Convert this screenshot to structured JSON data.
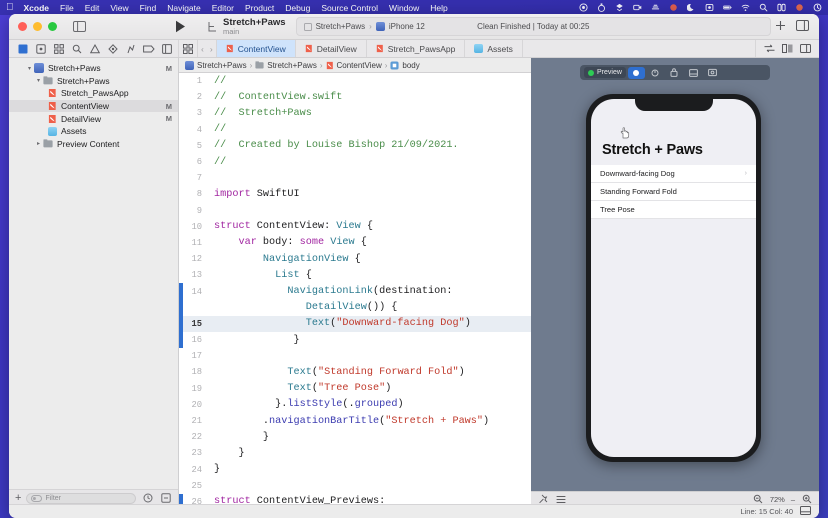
{
  "menubar": {
    "apple_icon": "apple-icon",
    "items": [
      {
        "label": "Xcode",
        "bold": true
      },
      {
        "label": "File",
        "bold": false
      },
      {
        "label": "Edit",
        "bold": false
      },
      {
        "label": "View",
        "bold": false
      },
      {
        "label": "Find",
        "bold": false
      },
      {
        "label": "Navigate",
        "bold": false
      },
      {
        "label": "Editor",
        "bold": false
      },
      {
        "label": "Product",
        "bold": false
      },
      {
        "label": "Debug",
        "bold": false
      },
      {
        "label": "Source Control",
        "bold": false
      },
      {
        "label": "Window",
        "bold": false
      },
      {
        "label": "Help",
        "bold": false
      }
    ],
    "status_icons": [
      "record-icon",
      "stopwatch-icon",
      "dropbox-icon",
      "screen-record-icon",
      "cloud-sync-icon",
      "adobe-icon",
      "moon-icon",
      "screenshot-icon",
      "battery-icon",
      "wifi-icon",
      "spotlight-icon",
      "control-center-icon",
      "notification-icon",
      "siri-icon"
    ]
  },
  "titlebar": {
    "traffic_lights": [
      "close",
      "minimize",
      "zoom"
    ],
    "sidebar_toggle": "sidebar-toggle-icon",
    "run_button": "run-icon",
    "scheme_name": "Stretch+Paws",
    "scheme_branch": "main",
    "scheme_target": "Stretch+Paws",
    "scheme_device": "iPhone 12",
    "build_status": "Clean Finished | Today at 00:25",
    "add_button": "plus-icon",
    "inspector_toggle": "inspector-toggle-icon"
  },
  "navigator_toolbar": {
    "icons": [
      "project-navigator-icon",
      "source-control-navigator-icon",
      "symbol-navigator-icon",
      "find-navigator-icon",
      "issue-navigator-icon",
      "test-navigator-icon",
      "debug-navigator-icon",
      "breakpoint-navigator-icon",
      "report-navigator-icon"
    ]
  },
  "editor_tabs": {
    "back_icon": "chevron-left-icon",
    "forward_icon": "chevron-right-icon",
    "grid_icon": "tab-overview-icon",
    "items": [
      {
        "label": "ContentView",
        "icon": "swift-file-icon",
        "active": true
      },
      {
        "label": "DetailView",
        "icon": "swift-file-icon",
        "active": false
      },
      {
        "label": "Stretch_PawsApp",
        "icon": "swift-file-icon",
        "active": false
      },
      {
        "label": "Assets",
        "icon": "assets-icon",
        "active": false
      }
    ],
    "right_icons": [
      "code-review-icon",
      "adjust-editor-icon",
      "add-editor-icon"
    ]
  },
  "navigator": {
    "tree": [
      {
        "indent": 0,
        "twisty": "open",
        "icon": "project-icon",
        "label": "Stretch+Paws",
        "modified": "M",
        "selected": false
      },
      {
        "indent": 1,
        "twisty": "open",
        "icon": "folder-icon",
        "label": "Stretch+Paws",
        "modified": "",
        "selected": false
      },
      {
        "indent": 2,
        "twisty": "none",
        "icon": "swift-file-icon",
        "label": "Stretch_PawsApp",
        "modified": "",
        "selected": false
      },
      {
        "indent": 2,
        "twisty": "none",
        "icon": "swift-file-icon",
        "label": "ContentView",
        "modified": "M",
        "selected": true
      },
      {
        "indent": 2,
        "twisty": "none",
        "icon": "swift-file-icon",
        "label": "DetailView",
        "modified": "M",
        "selected": false
      },
      {
        "indent": 2,
        "twisty": "none",
        "icon": "assets-icon",
        "label": "Assets",
        "modified": "",
        "selected": false
      },
      {
        "indent": 1,
        "twisty": "closed",
        "icon": "folder-icon",
        "label": "Preview Content",
        "modified": "",
        "selected": false
      }
    ],
    "filter": {
      "add_label": "+",
      "placeholder": "Filter",
      "filter_icon": "filter-oval-icon",
      "right_icons": [
        "recent-files-icon",
        "source-control-filter-icon"
      ]
    }
  },
  "jumpbar": {
    "crumbs": [
      {
        "label": "Stretch+Paws",
        "icon": "project-icon"
      },
      {
        "label": "Stretch+Paws",
        "icon": "folder-icon"
      },
      {
        "label": "ContentView",
        "icon": "swift-file-icon"
      },
      {
        "label": "body",
        "icon": "property-icon"
      }
    ],
    "separator": "›"
  },
  "code": {
    "lines": [
      {
        "n": 1,
        "highlight": false,
        "marker": "",
        "tokens": [
          {
            "t": "//",
            "c": "comment"
          }
        ]
      },
      {
        "n": 2,
        "highlight": false,
        "marker": "",
        "tokens": [
          {
            "t": "//  ContentView.swift",
            "c": "comment"
          }
        ]
      },
      {
        "n": 3,
        "highlight": false,
        "marker": "",
        "tokens": [
          {
            "t": "//  Stretch+Paws",
            "c": "comment"
          }
        ]
      },
      {
        "n": 4,
        "highlight": false,
        "marker": "",
        "tokens": [
          {
            "t": "//",
            "c": "comment"
          }
        ]
      },
      {
        "n": 5,
        "highlight": false,
        "marker": "",
        "tokens": [
          {
            "t": "//  Created by Louise Bishop 21/09/2021.",
            "c": "comment"
          }
        ]
      },
      {
        "n": 6,
        "highlight": false,
        "marker": "",
        "tokens": [
          {
            "t": "//",
            "c": "comment"
          }
        ]
      },
      {
        "n": 7,
        "highlight": false,
        "marker": "",
        "tokens": [
          {
            "t": "",
            "c": "plain"
          }
        ]
      },
      {
        "n": 8,
        "highlight": false,
        "marker": "",
        "tokens": [
          {
            "t": "import",
            "c": "key"
          },
          {
            "t": " SwiftUI",
            "c": "plain"
          }
        ]
      },
      {
        "n": 9,
        "highlight": false,
        "marker": "",
        "tokens": [
          {
            "t": "",
            "c": "plain"
          }
        ]
      },
      {
        "n": 10,
        "highlight": false,
        "marker": "",
        "tokens": [
          {
            "t": "struct",
            "c": "key"
          },
          {
            "t": " ContentView",
            "c": "plain"
          },
          {
            "t": ": ",
            "c": "plain"
          },
          {
            "t": "View",
            "c": "type"
          },
          {
            "t": " {",
            "c": "plain"
          }
        ]
      },
      {
        "n": 11,
        "highlight": false,
        "marker": "",
        "tokens": [
          {
            "t": "    ",
            "c": "plain"
          },
          {
            "t": "var",
            "c": "key"
          },
          {
            "t": " body: ",
            "c": "plain"
          },
          {
            "t": "some",
            "c": "key"
          },
          {
            "t": " ",
            "c": "plain"
          },
          {
            "t": "View",
            "c": "type"
          },
          {
            "t": " {",
            "c": "plain"
          }
        ]
      },
      {
        "n": 12,
        "highlight": false,
        "marker": "",
        "tokens": [
          {
            "t": "        ",
            "c": "plain"
          },
          {
            "t": "NavigationView",
            "c": "type"
          },
          {
            "t": " {",
            "c": "plain"
          }
        ]
      },
      {
        "n": 13,
        "highlight": false,
        "marker": "",
        "tokens": [
          {
            "t": "          ",
            "c": "plain"
          },
          {
            "t": "List",
            "c": "type"
          },
          {
            "t": " {",
            "c": "plain"
          }
        ]
      },
      {
        "n": 14,
        "highlight": false,
        "marker": "run",
        "tokens": [
          {
            "t": "            ",
            "c": "plain"
          },
          {
            "t": "NavigationLink",
            "c": "type"
          },
          {
            "t": "(destination:",
            "c": "plain"
          }
        ]
      },
      {
        "n": "",
        "highlight": false,
        "marker": "run",
        "tokens": [
          {
            "t": "               ",
            "c": "plain"
          },
          {
            "t": "DetailView",
            "c": "type"
          },
          {
            "t": "()) {",
            "c": "plain"
          }
        ]
      },
      {
        "n": 15,
        "highlight": true,
        "marker": "run",
        "tokens": [
          {
            "t": "               ",
            "c": "plain"
          },
          {
            "t": "Text",
            "c": "type"
          },
          {
            "t": "(",
            "c": "plain"
          },
          {
            "t": "\"Downward-facing Dog\"",
            "c": "str"
          },
          {
            "t": ")",
            "c": "plain"
          }
        ]
      },
      {
        "n": 16,
        "highlight": false,
        "marker": "run",
        "tokens": [
          {
            "t": "             }",
            "c": "plain"
          }
        ]
      },
      {
        "n": 17,
        "highlight": false,
        "marker": "",
        "tokens": [
          {
            "t": "",
            "c": "plain"
          }
        ]
      },
      {
        "n": 18,
        "highlight": false,
        "marker": "",
        "tokens": [
          {
            "t": "            ",
            "c": "plain"
          },
          {
            "t": "Text",
            "c": "type"
          },
          {
            "t": "(",
            "c": "plain"
          },
          {
            "t": "\"Standing Forward Fold\"",
            "c": "str"
          },
          {
            "t": ")",
            "c": "plain"
          }
        ]
      },
      {
        "n": 19,
        "highlight": false,
        "marker": "",
        "tokens": [
          {
            "t": "            ",
            "c": "plain"
          },
          {
            "t": "Text",
            "c": "type"
          },
          {
            "t": "(",
            "c": "plain"
          },
          {
            "t": "\"Tree Pose\"",
            "c": "str"
          },
          {
            "t": ")",
            "c": "plain"
          }
        ]
      },
      {
        "n": 20,
        "highlight": false,
        "marker": "",
        "tokens": [
          {
            "t": "          }.",
            "c": "plain"
          },
          {
            "t": "listStyle",
            "c": "fn"
          },
          {
            "t": "(.",
            "c": "plain"
          },
          {
            "t": "grouped",
            "c": "fn"
          },
          {
            "t": ")",
            "c": "plain"
          }
        ]
      },
      {
        "n": 21,
        "highlight": false,
        "marker": "",
        "tokens": [
          {
            "t": "        .",
            "c": "plain"
          },
          {
            "t": "navigationBarTitle",
            "c": "fn"
          },
          {
            "t": "(",
            "c": "plain"
          },
          {
            "t": "\"Stretch + Paws\"",
            "c": "str"
          },
          {
            "t": ")",
            "c": "plain"
          }
        ]
      },
      {
        "n": 22,
        "highlight": false,
        "marker": "",
        "tokens": [
          {
            "t": "        }",
            "c": "plain"
          }
        ]
      },
      {
        "n": 23,
        "highlight": false,
        "marker": "",
        "tokens": [
          {
            "t": "    }",
            "c": "plain"
          }
        ]
      },
      {
        "n": 24,
        "highlight": false,
        "marker": "",
        "tokens": [
          {
            "t": "}",
            "c": "plain"
          }
        ]
      },
      {
        "n": 25,
        "highlight": false,
        "marker": "",
        "tokens": [
          {
            "t": "",
            "c": "plain"
          }
        ]
      },
      {
        "n": 26,
        "highlight": false,
        "marker": "run",
        "tokens": [
          {
            "t": "struct",
            "c": "key"
          },
          {
            "t": " ContentView_Previews",
            "c": "plain"
          },
          {
            "t": ":",
            "c": "plain"
          }
        ]
      }
    ]
  },
  "preview": {
    "toolbar": {
      "live_label": "Preview",
      "live_dot_color": "#2ecc55",
      "buttons": [
        "live-preview-icon",
        "debug-preview-icon",
        "device-settings-icon",
        "duplicate-preview-icon",
        "inspect-preview-icon"
      ]
    },
    "device": {
      "name": "iPhone 12",
      "nav_title": "Stretch + Paws",
      "rows": [
        {
          "label": "Downward-facing Dog",
          "chevron": true
        },
        {
          "label": "Standing Forward Fold",
          "chevron": false
        },
        {
          "label": "Tree Pose",
          "chevron": false
        }
      ],
      "cursor": "pointing-hand-cursor"
    },
    "bottombar": {
      "left_icons": [
        "pin-preview-icon",
        "variants-icon"
      ],
      "zoom_out": "zoom-out-icon",
      "zoom_level": "72%",
      "zoom_reset": "–",
      "zoom_in": "zoom-in-icon"
    }
  },
  "status_strip": {
    "cursor_position": "Line: 15  Col: 40",
    "debug_toggle": "debug-area-toggle-icon"
  },
  "colors": {
    "accent": "#2f6fd0",
    "tab_active_bg": "#cfe3fb",
    "comment": "#4a8d4a",
    "keyword": "#a126a1",
    "string": "#c0392b",
    "type": "#2b7a8f",
    "desktop": "#4030cf"
  }
}
